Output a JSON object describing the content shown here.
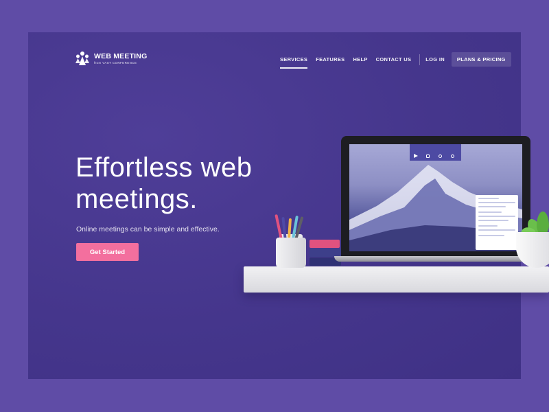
{
  "brand": {
    "title": "WEB MEETING",
    "subtitle": "from VAST CONFERENCE",
    "logo_icon": "people-group-icon"
  },
  "nav": {
    "items": [
      {
        "label": "SERVICES",
        "active": true
      },
      {
        "label": "FEATURES",
        "active": false
      },
      {
        "label": "HELP",
        "active": false
      },
      {
        "label": "CONTACT US",
        "active": false
      }
    ],
    "login_label": "LOG IN",
    "cta_label": "PLANS & PRICING"
  },
  "hero": {
    "headline_line1": "Effortless web",
    "headline_line2": "meetings.",
    "subtitle": "Online meetings can be simple and effective.",
    "cta_label": "Get Started"
  },
  "colors": {
    "page_bg": "#5f4ca6",
    "hero_bg": "#45368c",
    "accent_pink": "#f36f9e"
  }
}
